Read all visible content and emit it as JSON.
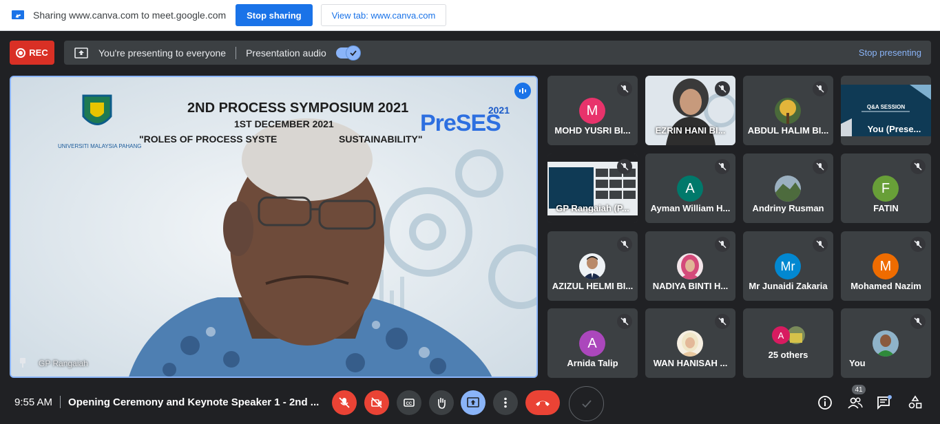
{
  "sharebar": {
    "text": "Sharing www.canva.com to meet.google.com",
    "stop_sharing": "Stop sharing",
    "view_tab": "View tab: www.canva.com"
  },
  "rec": {
    "label": "REC"
  },
  "presenting": {
    "text": "You're presenting to everyone",
    "audio_label": "Presentation audio",
    "stop_label": "Stop presenting"
  },
  "main": {
    "speaker": "GP Rangaiah",
    "slide": {
      "title": "2ND PROCESS SYMPOSIUM 2021",
      "date": "1ST DECEMBER 2021",
      "theme_left": "\"ROLES OF PROCESS SYSTE",
      "theme_right": "SUSTAINABILITY\"",
      "university": "UNIVERSITI MALAYSIA PAHANG",
      "brand_year": "2021",
      "brand": "PreSES"
    }
  },
  "participants": [
    {
      "name": "MOHD YUSRI BI...",
      "initial": "M",
      "color": "#e8336b"
    },
    {
      "name": "EZRIN HANI BI...",
      "initial": "",
      "color": ""
    },
    {
      "name": "ABDUL HALIM BI...",
      "initial": "",
      "color": ""
    },
    {
      "name": "You (Prese...",
      "initial": "",
      "color": ""
    },
    {
      "name": "GP Rangaiah (P...",
      "initial": "",
      "color": ""
    },
    {
      "name": "Ayman William H...",
      "initial": "A",
      "color": "#00796b"
    },
    {
      "name": "Andriny Rusman",
      "initial": "",
      "color": ""
    },
    {
      "name": "FATIN",
      "initial": "F",
      "color": "#689f38"
    },
    {
      "name": "AZIZUL HELMI BI...",
      "initial": "",
      "color": ""
    },
    {
      "name": "NADIYA BINTI H...",
      "initial": "",
      "color": ""
    },
    {
      "name": "Mr Junaidi Zakaria",
      "initial": "Mr",
      "color": "#0288d1"
    },
    {
      "name": "Mohamed Nazim",
      "initial": "M",
      "color": "#ef6c00"
    },
    {
      "name": "Arnida Talip",
      "initial": "A",
      "color": "#ab47bc"
    },
    {
      "name": "WAN HANISAH ...",
      "initial": "",
      "color": ""
    },
    {
      "name": "25 others",
      "initial": "A",
      "color": "#d81b60"
    },
    {
      "name": "You",
      "initial": "",
      "color": ""
    }
  ],
  "qa_slide_title": "Q&A SESSION",
  "bottom": {
    "time": "9:55 AM",
    "meeting_title": "Opening Ceremony and Keynote Speaker 1 - 2nd ...",
    "people_count": "41"
  },
  "colors": {
    "accent": "#8ab4f8",
    "danger": "#ea4335",
    "share_blue": "#1a73e8"
  }
}
